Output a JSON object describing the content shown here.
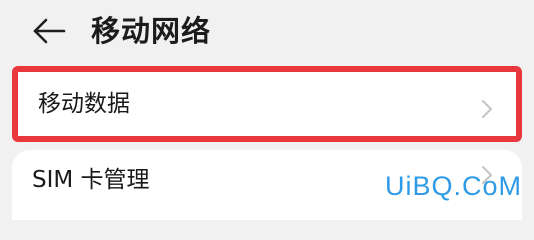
{
  "header": {
    "title": "移动网络",
    "back_icon": "arrow-left-icon"
  },
  "items": [
    {
      "label": "移动数据",
      "icon": "chevron-right-icon",
      "highlighted": true
    },
    {
      "label": "SIM 卡管理",
      "icon": "chevron-right-icon"
    }
  ],
  "watermark": {
    "text": "UiBQ.CoM"
  },
  "colors": {
    "background": "#f1f1f1",
    "card": "#ffffff",
    "highlight_border": "#e8383d",
    "chevron": "#c4c4c4",
    "watermark": "#2f9be6"
  }
}
